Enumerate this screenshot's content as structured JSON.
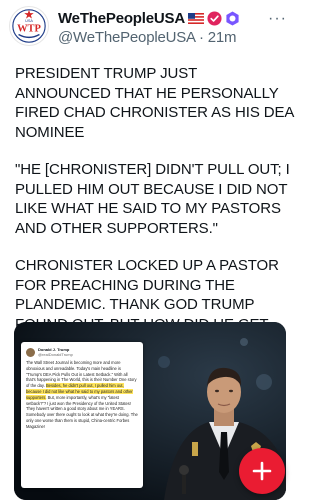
{
  "account": {
    "display_name": "WeThePeopleUSA",
    "handle": "@WeThePeopleUSA",
    "separator": " · ",
    "time": "21m",
    "avatar_text": "WTP",
    "avatar_top_text": "USA",
    "more_label": "···"
  },
  "tweet": {
    "paragraphs": [
      "PRESIDENT TRUMP JUST ANNOUNCED THAT HE PERSONALLY FIRED CHAD CHRONISTER AS HIS DEA NOMINEE",
      "\"HE [CHRONISTER] DIDN'T PULL OUT; I PULLED HIM OUT BECAUSE I DID NOT LIKE WHAT HE SAID TO MY PASTORS AND OTHER SUPPORTERS.\"",
      "CHRONISTER LOCKED UP A PASTOR FOR PREACHING DURING THE PLANDEMIC. THANK GOD TRUMP FOUND OUT, BUT HOW DID HE GET PICKED IN THE FIRST PLACE?"
    ]
  },
  "embedded_post": {
    "name": "Donald J. Trump",
    "handle": "@realDonaldTrump",
    "body_before": "The Wall Street Journal is becoming more and more obnoxious and unreadable. Today's main headline is \"Trump's DEA Pick Pulls Out in Latest Setback.\" With all that's happening in The World, this is their Number One story of the day. ",
    "body_highlight": "Besides, he didn't pull out, I pulled him out, because I did not like what he said to my pastors and other supporters.",
    "body_after": " But, more importantly, what's my \"latest setback?\"? I just won the Presidency of the United States! They haven't written a good story about me in YEARS. Somebody over there ought to look at what they're doing. The only one worse than them is stupid, China-centric Forbes Magazine!"
  },
  "colors": {
    "text": "#0f1419",
    "secondary": "#536471",
    "fab": "#ea1c32",
    "verified_red": "#e0245e",
    "subscriber_purple": "#7856ff",
    "highlight": "#ffe55c"
  },
  "icons": {
    "flag": "us-flag-icon",
    "verified": "verified-badge-icon",
    "subscriber": "hexagon-badge-icon",
    "more": "more-options-icon",
    "compose": "plus-icon"
  }
}
